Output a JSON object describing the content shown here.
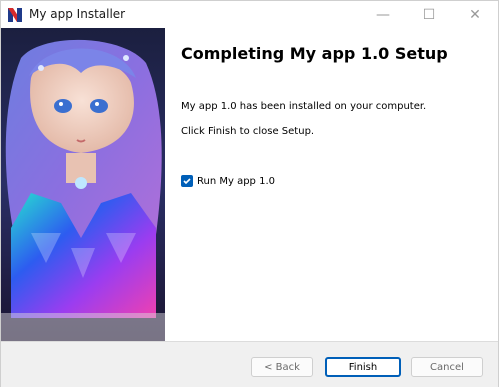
{
  "window": {
    "title": "My app Installer",
    "minimize_glyph": "—",
    "maximize_glyph": "☐",
    "close_glyph": "✕"
  },
  "content": {
    "heading": "Completing My app 1.0 Setup",
    "installed_text": "My app 1.0 has been installed on your computer.",
    "finish_text": "Click Finish to close Setup.",
    "run_checkbox": {
      "label": "Run My app 1.0",
      "checked": true
    }
  },
  "footer": {
    "back_label": "< Back",
    "finish_label": "Finish",
    "cancel_label": "Cancel"
  },
  "colors": {
    "accent": "#005fb8"
  }
}
